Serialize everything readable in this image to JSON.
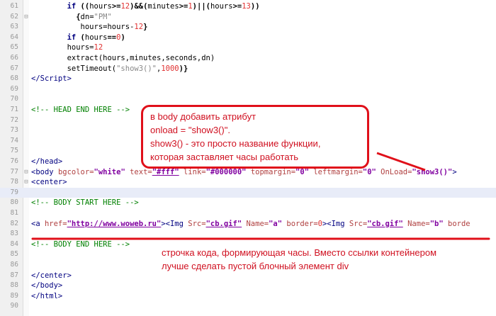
{
  "editor": {
    "highlighted_line": 79,
    "lines": [
      {
        "n": 61,
        "fold": "",
        "t": [
          [
            "kw",
            "        if "
          ],
          [
            "op",
            "(("
          ],
          [
            "tx",
            "hours"
          ],
          [
            "op",
            ">="
          ],
          [
            "num",
            "12"
          ],
          [
            "op",
            ")&&("
          ],
          [
            "tx",
            "minutes"
          ],
          [
            "op",
            ">="
          ],
          [
            "num",
            "1"
          ],
          [
            "op",
            ")||("
          ],
          [
            "tx",
            "hours"
          ],
          [
            "op",
            ">="
          ],
          [
            "num",
            "13"
          ],
          [
            "op",
            "))"
          ]
        ]
      },
      {
        "n": 62,
        "fold": "⊟",
        "t": [
          [
            "op",
            "          {"
          ],
          [
            "tx",
            "dn="
          ],
          [
            "str",
            "\"PM\""
          ]
        ]
      },
      {
        "n": 63,
        "fold": "",
        "t": [
          [
            "tx",
            "           hours=hours-"
          ],
          [
            "num",
            "12"
          ],
          [
            "op",
            "}"
          ]
        ]
      },
      {
        "n": 64,
        "fold": "",
        "t": [
          [
            "kw",
            "        if "
          ],
          [
            "op",
            "("
          ],
          [
            "tx",
            "hours"
          ],
          [
            "op",
            "=="
          ],
          [
            "num",
            "0"
          ],
          [
            "op",
            ")"
          ]
        ]
      },
      {
        "n": 65,
        "fold": "",
        "t": [
          [
            "tx",
            "        hours="
          ],
          [
            "num",
            "12"
          ]
        ]
      },
      {
        "n": 66,
        "fold": "",
        "t": [
          [
            "tx",
            "        extract(hours,minutes,seconds,dn)"
          ]
        ]
      },
      {
        "n": 67,
        "fold": "",
        "t": [
          [
            "tx",
            "        setTimeout("
          ],
          [
            "str",
            "\"show3()\""
          ],
          [
            "tx",
            ","
          ],
          [
            "num",
            "1000"
          ],
          [
            "op",
            ")}"
          ]
        ]
      },
      {
        "n": 68,
        "fold": "",
        "t": [
          [
            "tag",
            "</Script>"
          ]
        ]
      },
      {
        "n": 69,
        "fold": "",
        "t": []
      },
      {
        "n": 70,
        "fold": "",
        "t": []
      },
      {
        "n": 71,
        "fold": "",
        "t": [
          [
            "cm",
            "<!-- HEAD END HERE -->"
          ]
        ]
      },
      {
        "n": 72,
        "fold": "",
        "t": []
      },
      {
        "n": 73,
        "fold": "",
        "t": []
      },
      {
        "n": 74,
        "fold": "",
        "t": []
      },
      {
        "n": 75,
        "fold": "",
        "t": []
      },
      {
        "n": 76,
        "fold": "",
        "t": [
          [
            "tag",
            "</head>"
          ]
        ]
      },
      {
        "n": 77,
        "fold": "⊟",
        "t": [
          [
            "tag",
            "<body "
          ],
          [
            "attr",
            "bgcolor="
          ],
          [
            "val",
            "\"white\""
          ],
          [
            "attr",
            " text="
          ],
          [
            "val",
            "\"#fff\""
          ],
          [
            "attr",
            " link="
          ],
          [
            "val",
            "\"#000000\""
          ],
          [
            "attr",
            " topmargin="
          ],
          [
            "val",
            "\"0\""
          ],
          [
            "attr",
            " leftmargin="
          ],
          [
            "val",
            "\"0\""
          ],
          [
            "attr",
            " OnLoad="
          ],
          [
            "val",
            "\"show3()\""
          ],
          [
            "tag",
            ">"
          ]
        ]
      },
      {
        "n": 78,
        "fold": "⊟",
        "t": [
          [
            "tag",
            "<center>"
          ]
        ]
      },
      {
        "n": 79,
        "fold": "",
        "t": []
      },
      {
        "n": 80,
        "fold": "",
        "t": [
          [
            "cm",
            "<!-- BODY START HERE -->"
          ]
        ]
      },
      {
        "n": 81,
        "fold": "",
        "t": []
      },
      {
        "n": 82,
        "fold": "",
        "t": [
          [
            "tag",
            "<a "
          ],
          [
            "attr",
            "href="
          ],
          [
            "val",
            "\"http://www.woweb.ru\""
          ],
          [
            "tag",
            "><Img "
          ],
          [
            "attr",
            "Src="
          ],
          [
            "val",
            "\"cb.gif\""
          ],
          [
            "attr",
            " Name="
          ],
          [
            "val",
            "\"a\""
          ],
          [
            "attr",
            " border="
          ],
          [
            "num",
            "0"
          ],
          [
            "tag",
            "><Img "
          ],
          [
            "attr",
            "Src="
          ],
          [
            "val",
            "\"cb.gif\""
          ],
          [
            "attr",
            " Name="
          ],
          [
            "val",
            "\"b\""
          ],
          [
            "attr",
            " borde"
          ]
        ]
      },
      {
        "n": 83,
        "fold": "",
        "t": []
      },
      {
        "n": 84,
        "fold": "",
        "t": [
          [
            "cm",
            "<!-- BODY END HERE -->"
          ]
        ]
      },
      {
        "n": 85,
        "fold": "",
        "t": []
      },
      {
        "n": 86,
        "fold": "",
        "t": []
      },
      {
        "n": 87,
        "fold": "",
        "t": [
          [
            "tag",
            "</center>"
          ]
        ]
      },
      {
        "n": 88,
        "fold": "",
        "t": [
          [
            "tag",
            "</body>"
          ]
        ]
      },
      {
        "n": 89,
        "fold": "",
        "t": [
          [
            "tag",
            "</html>"
          ]
        ]
      },
      {
        "n": 90,
        "fold": "",
        "t": []
      }
    ]
  },
  "annotations": {
    "box": [
      "в body добавить атрибут",
      "onload = \"show3()\".",
      "show3() - это просто название функции,",
      "которая заставляет часы работать"
    ],
    "clock_note": [
      "строчка кода, формирующая часы. Вместо ссылки контейнером",
      "лучше сделать пустой блочный элемент div"
    ],
    "color": "#e0101a"
  }
}
